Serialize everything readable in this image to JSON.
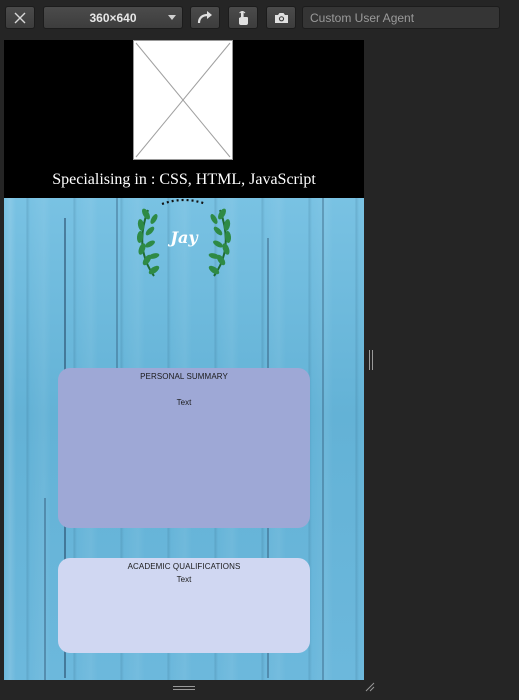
{
  "toolbar": {
    "close_icon": "close-icon",
    "size_label": "360×640",
    "rotate_icon": "rotate-icon",
    "touch_icon": "touch-icon",
    "screenshot_icon": "camera-icon",
    "user_agent_placeholder": "Custom User Agent",
    "user_agent_value": ""
  },
  "page": {
    "header_text": "Specialising in : CSS, HTML, JavaScript",
    "logo_text": "Jay",
    "summary": {
      "title": "PERSONAL SUMMARY",
      "text": "Text"
    },
    "academic": {
      "title": "ACADEMIC QUALIFICATIONS",
      "text": "Text"
    }
  },
  "colors": {
    "chrome_bg": "#252525",
    "wood_blue": "#6fbadd",
    "summary_card": "#9ea8d6",
    "academic_card": "#d0d7f2",
    "laurel_green": "#2e8a45"
  }
}
